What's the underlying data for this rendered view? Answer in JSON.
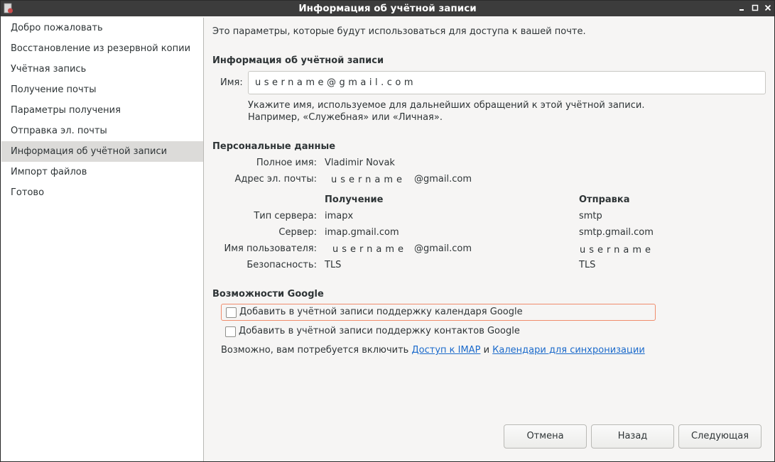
{
  "window": {
    "title": "Информация об учётной записи"
  },
  "sidebar": {
    "items": [
      {
        "label": "Добро пожаловать"
      },
      {
        "label": "Восстановление из резервной копии"
      },
      {
        "label": "Учётная запись"
      },
      {
        "label": "Получение почты"
      },
      {
        "label": "Параметры получения"
      },
      {
        "label": "Отправка эл. почты"
      },
      {
        "label": "Информация об учётной записи",
        "active": true
      },
      {
        "label": "Импорт файлов"
      },
      {
        "label": "Готово"
      }
    ]
  },
  "main": {
    "intro": "Это параметры, которые будут использоваться для доступа к вашей почте.",
    "account_section": "Информация об учётной записи",
    "name_label": "Имя:",
    "name_value": "username@gmail.com",
    "hint_line1": "Укажите имя, используемое для дальнейших обращений к этой учётной записи.",
    "hint_line2": "Например, «Служебная» или «Личная».",
    "personal_section": "Персональные данные",
    "fullname_label": "Полное имя:",
    "fullname_value": "Vladimir Novak",
    "email_label": "Адрес эл. почты:",
    "email_user": "username",
    "email_domain": "@gmail.com",
    "receive_header": "Получение",
    "send_header": "Отправка",
    "server_type_label": "Тип сервера:",
    "server_label": "Сервер:",
    "username_label": "Имя пользователя:",
    "security_label": "Безопасность:",
    "receive": {
      "server_type": "imapx",
      "server": "imap.gmail.com",
      "username_user": "username",
      "username_domain": "@gmail.com",
      "security": "TLS"
    },
    "send": {
      "server_type": "smtp",
      "server": "smtp.gmail.com",
      "username": "username",
      "security": "TLS"
    },
    "google_section": "Возможности Google",
    "calendar_checkbox": "Добавить в учётной записи поддержку календаря Google",
    "contacts_checkbox": "Добавить в учётной записи поддержку контактов Google",
    "note_prefix": "Возможно, вам потребуется включить",
    "imap_link": "Доступ к IMAP",
    "note_and": "и",
    "sync_link": "Календари для синхронизации"
  },
  "buttons": {
    "cancel": "Отмена",
    "back": "Назад",
    "next": "Следующая"
  },
  "colors": {
    "titlebar": "#3c3c3c",
    "active_item": "#dcdbd9",
    "link": "#1b6acb",
    "focus_border": "#f08c6c"
  }
}
